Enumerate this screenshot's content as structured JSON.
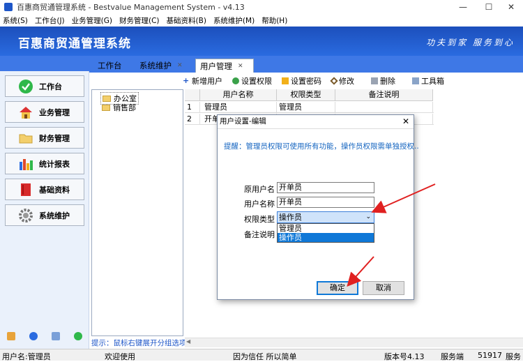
{
  "window": {
    "title": "百惠商贸通管理系统 - Bestvalue Management System - v4.13",
    "minimize": "—",
    "maximize": "☐",
    "close": "✕"
  },
  "menu": [
    "系统(S)",
    "工作台(J)",
    "业务管理(G)",
    "财务管理(C)",
    "基础资料(B)",
    "系统维护(M)",
    "帮助(H)"
  ],
  "banner": {
    "brand": "百惠商贸通管理系统",
    "slogan": "功夫到家  服务到心"
  },
  "nav": [
    {
      "label": "工作台",
      "icon": "check-circle-icon"
    },
    {
      "label": "业务管理",
      "icon": "house-icon"
    },
    {
      "label": "财务管理",
      "icon": "folder-icon"
    },
    {
      "label": "统计报表",
      "icon": "bar-chart-icon"
    },
    {
      "label": "基础资料",
      "icon": "book-icon"
    },
    {
      "label": "系统维护",
      "icon": "gear-icon"
    }
  ],
  "tabs": [
    {
      "label": "工作台",
      "closable": false
    },
    {
      "label": "系统维护",
      "closable": true
    },
    {
      "label": "用户管理",
      "closable": true
    }
  ],
  "toolbar": [
    {
      "label": "新增用户",
      "icon": "plus-icon"
    },
    {
      "label": "设置权限",
      "icon": "shield-icon"
    },
    {
      "label": "设置密码",
      "icon": "lock-icon"
    },
    {
      "label": "修改",
      "icon": "edit-icon"
    },
    {
      "label": "删除",
      "icon": "delete-icon"
    },
    {
      "label": "工具箱",
      "icon": "toolbox-icon"
    }
  ],
  "tree": [
    "办公室",
    "销售部"
  ],
  "tip": "提示：鼠标右键展开分组选项",
  "grid": {
    "columns": [
      "用户名称",
      "权限类型",
      "备注说明"
    ],
    "rows": [
      {
        "no": "1",
        "name": "管理员",
        "type": "管理员",
        "note": ""
      },
      {
        "no": "2",
        "name": "开单员",
        "type": "",
        "note": ""
      }
    ]
  },
  "status": {
    "user": "用户名:管理员",
    "welcome": "欢迎使用",
    "motto": "因为信任 所以简单",
    "version": "版本号4.13",
    "server": "服务端",
    "port": "51917",
    "more": "服务"
  },
  "dialog": {
    "title": "用户设置-编辑",
    "close": "✕",
    "hint": "提醒：管理员权限可使用所有功能，操作员权限需单独授权..",
    "fields": {
      "original_name_label": "原用户名",
      "original_name_value": "开单员",
      "name_label": "用户名称",
      "name_value": "开单员",
      "type_label": "权限类型",
      "type_value": "操作员",
      "note_label": "备注说明"
    },
    "options": [
      "管理员",
      "操作员"
    ],
    "ok": "确定",
    "cancel": "取消"
  },
  "colors": {
    "brand_blue": "#1c4fbc",
    "accent": "#0f78d7",
    "arrow": "#e02020"
  }
}
